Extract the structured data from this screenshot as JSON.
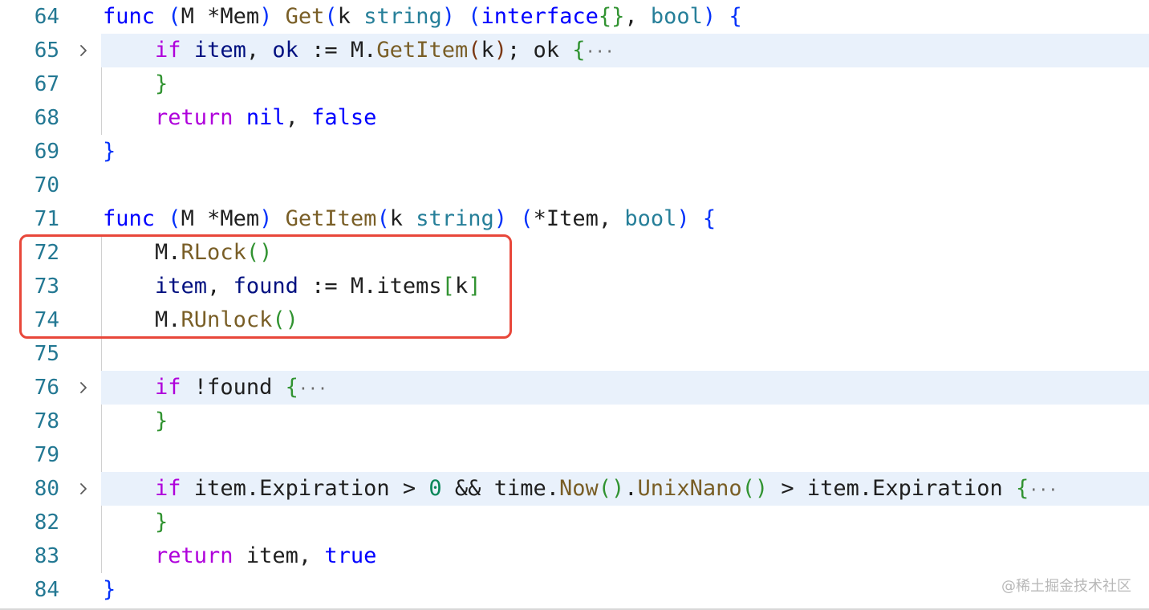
{
  "editor": {
    "lines": [
      {
        "number": "64",
        "folded": false,
        "tokens": [
          {
            "t": "func",
            "c": "kw"
          },
          {
            "t": " ",
            "c": "pl"
          },
          {
            "t": "(",
            "c": "b1"
          },
          {
            "t": "M *Mem",
            "c": "pl"
          },
          {
            "t": ")",
            "c": "b1"
          },
          {
            "t": " ",
            "c": "pl"
          },
          {
            "t": "Get",
            "c": "fn"
          },
          {
            "t": "(",
            "c": "b1"
          },
          {
            "t": "k ",
            "c": "pl"
          },
          {
            "t": "string",
            "c": "ty"
          },
          {
            "t": ")",
            "c": "b1"
          },
          {
            "t": " ",
            "c": "pl"
          },
          {
            "t": "(",
            "c": "b1"
          },
          {
            "t": "interface",
            "c": "kw"
          },
          {
            "t": "{}",
            "c": "b2"
          },
          {
            "t": ", ",
            "c": "pl"
          },
          {
            "t": "bool",
            "c": "ty"
          },
          {
            "t": ")",
            "c": "b1"
          },
          {
            "t": " ",
            "c": "pl"
          },
          {
            "t": "{",
            "c": "b1"
          }
        ]
      },
      {
        "number": "65",
        "folded": true,
        "tokens": [
          {
            "t": "    ",
            "c": "pl"
          },
          {
            "t": "if",
            "c": "ctl"
          },
          {
            "t": " ",
            "c": "pl"
          },
          {
            "t": "item",
            "c": "var"
          },
          {
            "t": ", ",
            "c": "pl"
          },
          {
            "t": "ok",
            "c": "var"
          },
          {
            "t": " := M.",
            "c": "pl"
          },
          {
            "t": "GetItem",
            "c": "fn"
          },
          {
            "t": "(",
            "c": "b3"
          },
          {
            "t": "k",
            "c": "pl"
          },
          {
            "t": ")",
            "c": "b3"
          },
          {
            "t": "; ok ",
            "c": "pl"
          },
          {
            "t": "{",
            "c": "b2"
          },
          {
            "t": "···",
            "c": "ell"
          }
        ]
      },
      {
        "number": "67",
        "folded": false,
        "tokens": [
          {
            "t": "    ",
            "c": "pl"
          },
          {
            "t": "}",
            "c": "b2"
          }
        ]
      },
      {
        "number": "68",
        "folded": false,
        "tokens": [
          {
            "t": "    ",
            "c": "pl"
          },
          {
            "t": "return",
            "c": "ctl"
          },
          {
            "t": " ",
            "c": "pl"
          },
          {
            "t": "nil",
            "c": "kw"
          },
          {
            "t": ", ",
            "c": "pl"
          },
          {
            "t": "false",
            "c": "kw"
          }
        ]
      },
      {
        "number": "69",
        "folded": false,
        "tokens": [
          {
            "t": "}",
            "c": "b1"
          }
        ]
      },
      {
        "number": "70",
        "folded": false,
        "tokens": []
      },
      {
        "number": "71",
        "folded": false,
        "tokens": [
          {
            "t": "func",
            "c": "kw"
          },
          {
            "t": " ",
            "c": "pl"
          },
          {
            "t": "(",
            "c": "b1"
          },
          {
            "t": "M *Mem",
            "c": "pl"
          },
          {
            "t": ")",
            "c": "b1"
          },
          {
            "t": " ",
            "c": "pl"
          },
          {
            "t": "GetItem",
            "c": "fn"
          },
          {
            "t": "(",
            "c": "b1"
          },
          {
            "t": "k ",
            "c": "pl"
          },
          {
            "t": "string",
            "c": "ty"
          },
          {
            "t": ")",
            "c": "b1"
          },
          {
            "t": " ",
            "c": "pl"
          },
          {
            "t": "(",
            "c": "b1"
          },
          {
            "t": "*Item, ",
            "c": "pl"
          },
          {
            "t": "bool",
            "c": "ty"
          },
          {
            "t": ")",
            "c": "b1"
          },
          {
            "t": " ",
            "c": "pl"
          },
          {
            "t": "{",
            "c": "b1"
          }
        ]
      },
      {
        "number": "72",
        "folded": false,
        "tokens": [
          {
            "t": "    M.",
            "c": "pl"
          },
          {
            "t": "RLock",
            "c": "fn"
          },
          {
            "t": "()",
            "c": "b2"
          }
        ]
      },
      {
        "number": "73",
        "folded": false,
        "tokens": [
          {
            "t": "    ",
            "c": "pl"
          },
          {
            "t": "item",
            "c": "var"
          },
          {
            "t": ", ",
            "c": "pl"
          },
          {
            "t": "found",
            "c": "var"
          },
          {
            "t": " := M.items",
            "c": "pl"
          },
          {
            "t": "[",
            "c": "b2"
          },
          {
            "t": "k",
            "c": "pl"
          },
          {
            "t": "]",
            "c": "b2"
          }
        ]
      },
      {
        "number": "74",
        "folded": false,
        "tokens": [
          {
            "t": "    M.",
            "c": "pl"
          },
          {
            "t": "RUnlock",
            "c": "fn"
          },
          {
            "t": "()",
            "c": "b2"
          }
        ]
      },
      {
        "number": "75",
        "folded": false,
        "tokens": []
      },
      {
        "number": "76",
        "folded": true,
        "tokens": [
          {
            "t": "    ",
            "c": "pl"
          },
          {
            "t": "if",
            "c": "ctl"
          },
          {
            "t": " !found ",
            "c": "pl"
          },
          {
            "t": "{",
            "c": "b2"
          },
          {
            "t": "···",
            "c": "ell"
          }
        ]
      },
      {
        "number": "78",
        "folded": false,
        "tokens": [
          {
            "t": "    ",
            "c": "pl"
          },
          {
            "t": "}",
            "c": "b2"
          }
        ]
      },
      {
        "number": "79",
        "folded": false,
        "tokens": []
      },
      {
        "number": "80",
        "folded": true,
        "tokens": [
          {
            "t": "    ",
            "c": "pl"
          },
          {
            "t": "if",
            "c": "ctl"
          },
          {
            "t": " item.Expiration > ",
            "c": "pl"
          },
          {
            "t": "0",
            "c": "num"
          },
          {
            "t": " && time.",
            "c": "pl"
          },
          {
            "t": "Now",
            "c": "fn"
          },
          {
            "t": "()",
            "c": "b2"
          },
          {
            "t": ".",
            "c": "pl"
          },
          {
            "t": "UnixNano",
            "c": "fn"
          },
          {
            "t": "()",
            "c": "b2"
          },
          {
            "t": " > item.Expiration ",
            "c": "pl"
          },
          {
            "t": "{",
            "c": "b2"
          },
          {
            "t": "···",
            "c": "ell"
          }
        ]
      },
      {
        "number": "82",
        "folded": false,
        "tokens": [
          {
            "t": "    ",
            "c": "pl"
          },
          {
            "t": "}",
            "c": "b2"
          }
        ]
      },
      {
        "number": "83",
        "folded": false,
        "tokens": [
          {
            "t": "    ",
            "c": "pl"
          },
          {
            "t": "return",
            "c": "ctl"
          },
          {
            "t": " item, ",
            "c": "pl"
          },
          {
            "t": "true",
            "c": "kw"
          }
        ]
      },
      {
        "number": "84",
        "folded": false,
        "tokens": [
          {
            "t": "}",
            "c": "b1"
          }
        ]
      }
    ],
    "fold_icon": "chevron-right-icon",
    "highlight_color": "#e8473a"
  },
  "watermark": "@稀土掘金技术社区"
}
